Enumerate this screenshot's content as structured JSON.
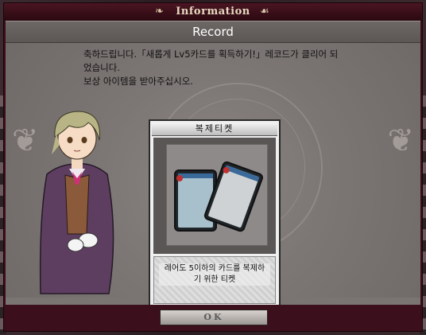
{
  "window": {
    "title": "Information",
    "subtitle": "Record"
  },
  "message": {
    "line1": "축하드립니다.「새롭게 Lv5카드를 획득하기!」레코드가 클리어 되",
    "line2": "었습니다.",
    "line3": "보상 아이템을 받아주십시오."
  },
  "reward": {
    "name": "복제티켓",
    "description_line1": "레어도 5이하의 카드를 복제하",
    "description_line2": "기 위한 티켓"
  },
  "footer": {
    "ok_label": "OK"
  },
  "icons": {
    "title_ornament": "scroll-ornament-icon",
    "reward_item": "card-duplicate-ticket-icon"
  },
  "colors": {
    "frame": "#3b0f1b",
    "panel": "#7a7472",
    "title_text": "#e8d9c0"
  }
}
